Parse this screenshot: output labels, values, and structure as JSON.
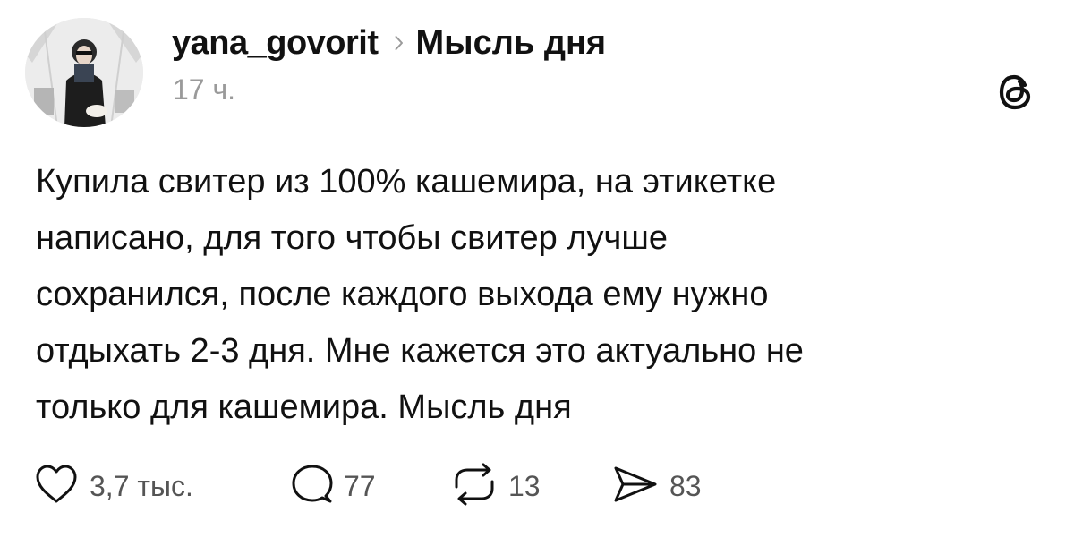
{
  "post": {
    "username": "yana_govorit",
    "topic": "Мысль дня",
    "time": "17 ч.",
    "text_lines": [
      "Купила свитер из 100% кашемира, на этикетке",
      "написано, для того чтобы свитер лучше",
      "сохранился, после каждого выхода ему нужно",
      "отдыхать 2-3 дня. Мне кажется это актуально не",
      "только для кашемира. Мысль дня"
    ]
  },
  "actions": {
    "likes": "3,7 тыс.",
    "replies": "77",
    "reposts": "13",
    "shares": "83"
  },
  "icons": {
    "brand": "threads-logo-icon",
    "like": "heart-icon",
    "reply": "comment-icon",
    "repost": "repost-icon",
    "share": "send-icon",
    "separator": "chevron-right-icon"
  },
  "colors": {
    "text": "#111111",
    "muted": "#9a9a9a",
    "counts": "#555555"
  }
}
